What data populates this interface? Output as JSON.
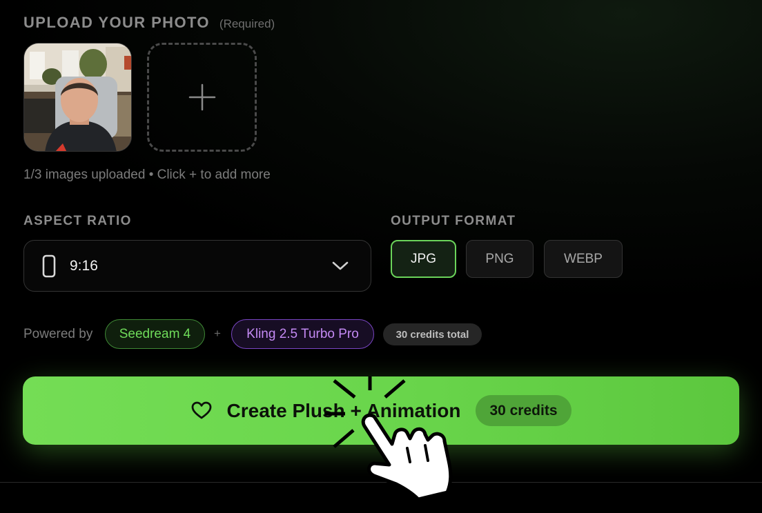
{
  "upload": {
    "title": "UPLOAD YOUR PHOTO",
    "required": "(Required)",
    "hint": "1/3 images uploaded • Click + to add more",
    "add_icon": "plus-icon"
  },
  "aspect_ratio": {
    "label": "ASPECT RATIO",
    "value": "9:16",
    "icon": "portrait-phone-icon"
  },
  "output_format": {
    "label": "OUTPUT FORMAT",
    "options": [
      "JPG",
      "PNG",
      "WEBP"
    ],
    "selected": "JPG"
  },
  "powered": {
    "label": "Powered by",
    "model_a": "Seedream 4",
    "separator": "+",
    "model_b": "Kling 2.5 Turbo Pro",
    "credits_total": "30 credits total"
  },
  "cta": {
    "label": "Create Plush + Animation",
    "credits": "30 credits",
    "icon": "heart-icon"
  },
  "colors": {
    "accent": "#6bd45a",
    "purple": "#c48af4",
    "background": "#000000"
  }
}
